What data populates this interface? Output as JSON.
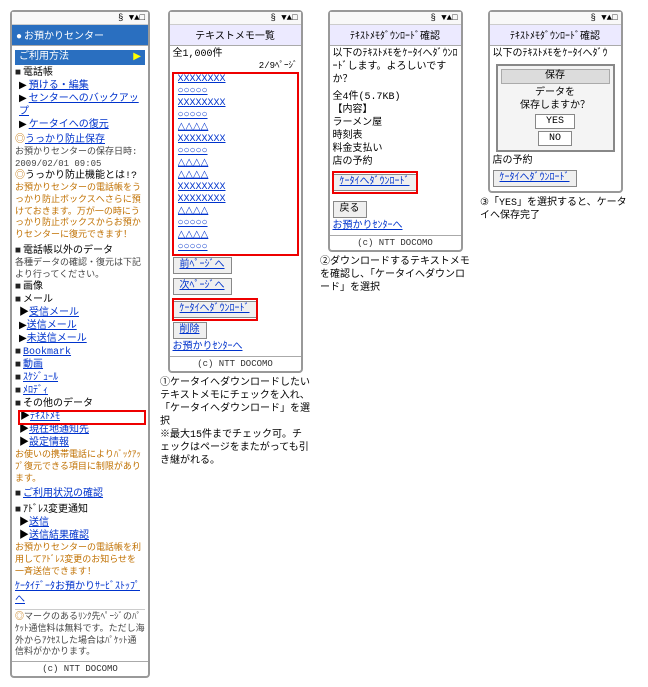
{
  "status": "§ ▼▲□",
  "copyright": "(c) NTT DOCOMO",
  "screen1": {
    "title": "お預かりセンター",
    "menu_head": "ご利用方法",
    "items": {
      "denwa": "電話帳",
      "link1": "預ける・編集",
      "link2": "センターへのバックアップ",
      "link3": "ケータイへの復元",
      "ukkari_title": "うっかり防止保存",
      "ukkari_date_lbl": "お預かりセンターの保存日時:",
      "ukkari_date": "2009/02/01 09:05",
      "ukkari_q": "うっかり防止機能とは!?",
      "ukkari_desc": "お預かりセンターの電話帳をうっかり防止ボックスへさらに預けておきます。万が一の時にうっかり防止ボックスからお預かりセンターに復元できます！",
      "others_title": "電話帳以外のデータ",
      "others_desc": "各種データの確認・復元は下記より行ってください。",
      "gazou": "画像",
      "mail": "メール",
      "mail1": "受信メール",
      "mail2": "送信メール",
      "mail3": "未送信メール",
      "bookmark": "Bookmark",
      "movie": "動画",
      "schedule": "ｽｹｼﾞｭｰﾙ",
      "todo": "ﾒﾛﾃﾞｨ",
      "other": "その他のデータ",
      "text_memo": "ﾃｷｽﾄﾒﾓ",
      "loc": "現在地通知先",
      "setting": "設定情報",
      "note": "お使いの携帯電話によりﾊﾞｯｸｱｯﾌﾟ復元できる項目に制限があります。",
      "usage": "ご利用状況の確認",
      "addr_head": "ｱﾄﾞﾚｽ変更通知",
      "addr1": "送信",
      "addr2": "送信結果確認",
      "addr_note": "お預かりセンターの電話帳を利用してｱﾄﾞﾚｽ変更のお知らせを一斉送信できます！",
      "svc_link": "ｹｰﾀｲﾃﾞｰﾀお預かりｻｰﾋﾞｽﾄｯﾌﾟへ",
      "foot_note": "マークのあるﾘﾝｸ先ﾍﾟｰｼﾞのﾊﾟｹｯﾄ通信料は無料です。ただし海外からｱｸｾｽした場合はﾊﾟｹｯﾄ通信料がかかります。"
    }
  },
  "screen2": {
    "title": "テキストメモ一覧",
    "total": "全1,000件",
    "page": "2/9ﾍﾟｰｼﾞ",
    "rows": [
      {
        "t": "XXXXXXXX",
        "c": "#0033cc",
        "i": "plain"
      },
      {
        "t": "○○○○○",
        "c": "#0033cc",
        "i": "plain"
      },
      {
        "t": "XXXXXXXX",
        "c": "#0033cc",
        "i": "plain"
      },
      {
        "t": "○○○○○",
        "c": "#0033cc",
        "i": "plain"
      },
      {
        "t": "△△△△",
        "c": "#0033cc",
        "i": "plain"
      },
      {
        "t": "XXXXXXXX",
        "c": "#0033cc",
        "i": "plain"
      },
      {
        "t": "○○○○○",
        "c": "#0033cc",
        "i": ""
      },
      {
        "t": "△△△△",
        "c": "#0033cc",
        "i": ""
      },
      {
        "t": "△△△△",
        "c": "#0033cc",
        "i": ""
      },
      {
        "t": "XXXXXXXX",
        "c": "#0033cc",
        "i": "plain"
      },
      {
        "t": "XXXXXXXX",
        "c": "#0033cc",
        "i": "plain"
      },
      {
        "t": "△△△△",
        "c": "#0033cc",
        "i": "plain"
      },
      {
        "t": "○○○○○",
        "c": "#0033cc",
        "i": "plain"
      },
      {
        "t": "△△△△",
        "c": "#0033cc",
        "i": "plain"
      },
      {
        "t": "○○○○○",
        "c": "#0033cc",
        "i": "plain"
      }
    ],
    "prev": "前ﾍﾟｰｼﾞへ",
    "next": "次ﾍﾟｰｼﾞへ",
    "dl": "ｹｰﾀｲへﾀﾞｳﾝﾛｰﾄﾞ",
    "del": "削除",
    "back": "お預かりｾﾝﾀｰへ"
  },
  "screen3": {
    "title": "ﾃｷｽﾄﾒﾓﾀﾞｳﾝﾛｰﾄﾞ確認",
    "msg": "以下のﾃｷｽﾄﾒﾓをｹｰﾀｲへﾀﾞｳﾝﾛｰﾄﾞします。よろしいですか？",
    "count": "全4件(5.7KB)",
    "hdr": "【内容】",
    "rows": [
      "ラーメン屋",
      "時刻表",
      "料金支払い",
      "店の予約"
    ],
    "dl": "ｹｰﾀｲへﾀﾞｳﾝﾛｰﾄﾞ",
    "back": "戻る",
    "center": "お預かりｾﾝﾀｰへ"
  },
  "screen4": {
    "title": "ﾃｷｽﾄﾒﾓﾀﾞｳﾝﾛｰﾄﾞ確認",
    "msg_top": "以下のﾃｷｽﾄﾒﾓをｹｰﾀｲへﾀﾞｳ",
    "dialog_title": "保存",
    "dialog_msg": "データを\n保存しますか？",
    "yes": "YES",
    "no": "NO",
    "rows": [
      "店の予約"
    ],
    "dl": "ｹｰﾀｲへﾀﾞｳﾝﾛｰﾄﾞ"
  },
  "captions": {
    "c1": "①ケータイへダウンロードしたいテキストメモにチェックを入れ、「ケータイへダウンロード」を選択",
    "c1b": "※最大15件までチェック可。チェックはページをまたがっても引き継がれる。",
    "c2": "②ダウンロードするテキストメモを確認し、「ケータイへダウンロード」を選択",
    "c3": "③「YES」を選択すると、ケータイへ保存完了"
  }
}
